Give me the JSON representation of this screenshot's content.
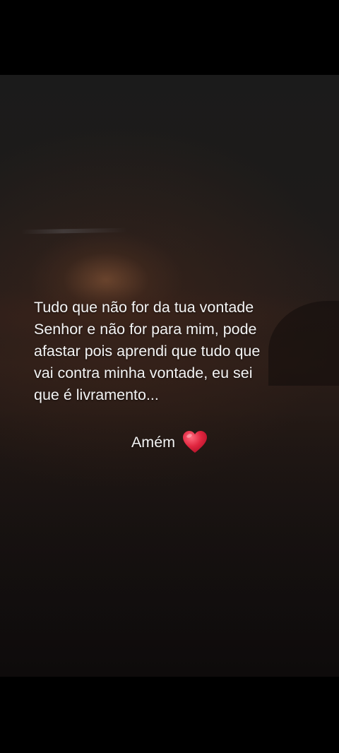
{
  "quote": {
    "lines": [
      "Tudo que não for da tua vontade",
      "Senhor e não for para mim, pode",
      "afastar pois aprendi que tudo que",
      "vai contra minha vontade, eu sei",
      "que é livramento..."
    ]
  },
  "closing": {
    "text": "Amém",
    "icon": "red-heart-emoji",
    "icon_color": "#e0263f"
  },
  "colors": {
    "text": "#f4f4f4",
    "letterbox": "#000000"
  }
}
